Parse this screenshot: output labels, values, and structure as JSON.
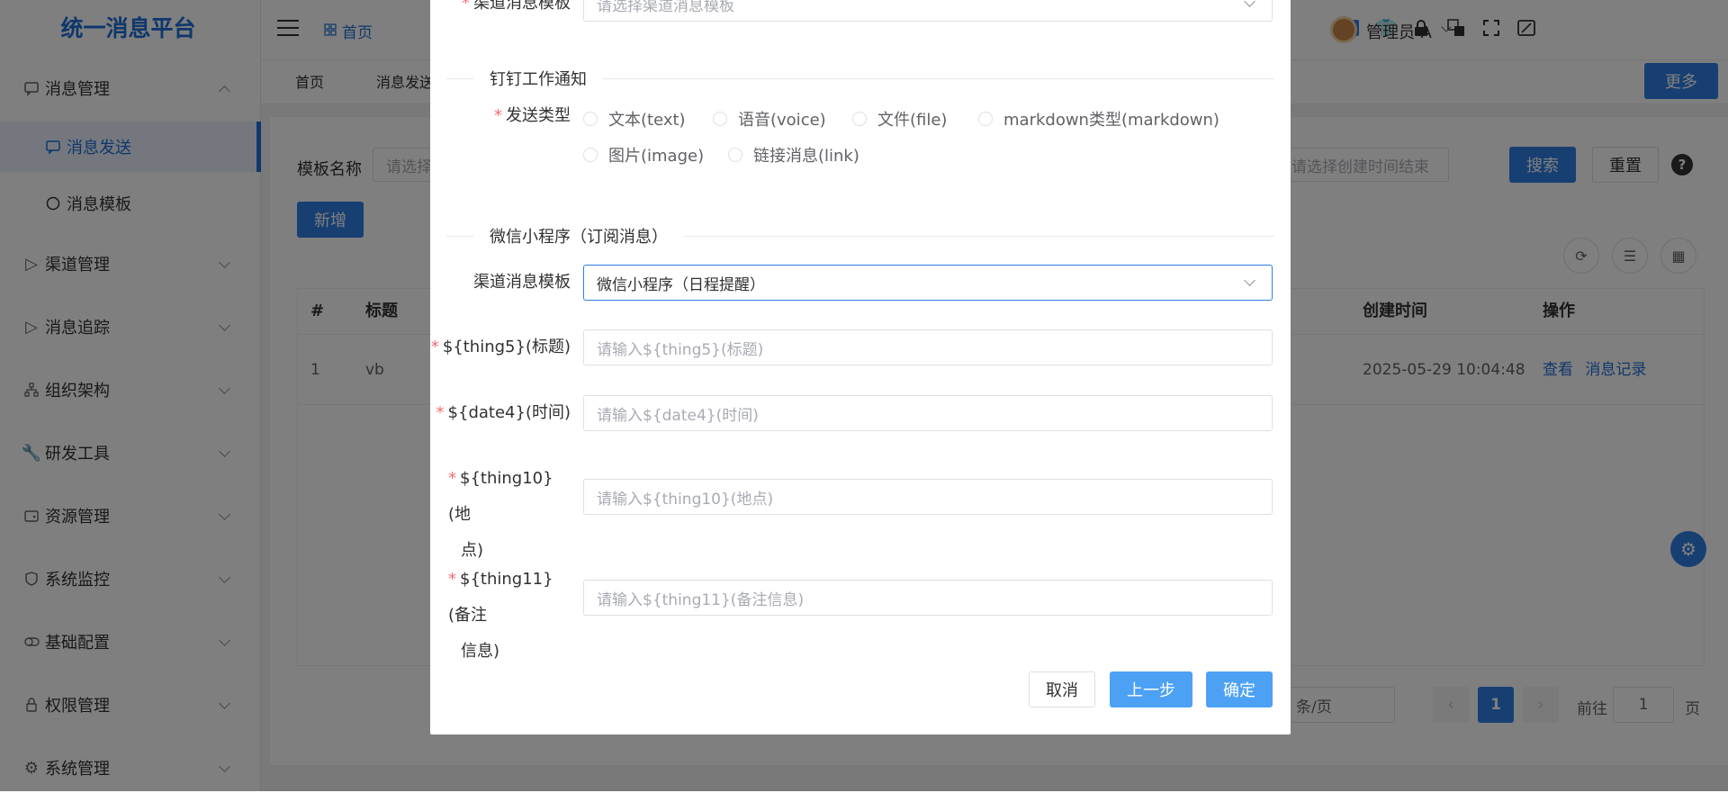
{
  "app": {
    "title": "统一消息平台"
  },
  "sidebar": {
    "items": [
      {
        "label": "消息管理",
        "icon": "message-icon"
      },
      {
        "label": "消息发送",
        "icon": "chat-icon",
        "active": true
      },
      {
        "label": "消息模板",
        "icon": "circle-icon"
      },
      {
        "label": "渠道管理",
        "icon": "send-icon"
      },
      {
        "label": "消息追踪",
        "icon": "send-icon"
      },
      {
        "label": "组织架构",
        "icon": "org-icon"
      },
      {
        "label": "研发工具",
        "icon": "wrench-icon"
      },
      {
        "label": "资源管理",
        "icon": "wallet-icon"
      },
      {
        "label": "系统监控",
        "icon": "shield-icon"
      },
      {
        "label": "基础配置",
        "icon": "toggle-icon"
      },
      {
        "label": "权限管理",
        "icon": "lock-icon"
      },
      {
        "label": "系统管理",
        "icon": "gear-icon"
      }
    ]
  },
  "header": {
    "breadcrumb": "首页",
    "user": "管理员-A"
  },
  "tabs": {
    "home": "首页",
    "current": "消息发送",
    "more": "更多"
  },
  "search": {
    "template_label": "模板名称",
    "template_placeholder": "请选择模板",
    "end_time_placeholder": "请选择创建时间结束",
    "search_btn": "搜索",
    "reset_btn": "重置",
    "add_btn": "新增"
  },
  "table": {
    "headers": {
      "index": "#",
      "title": "标题",
      "created": "创建时间",
      "actions": "操作"
    },
    "rows": [
      {
        "index": "1",
        "title": "vb",
        "created": "2025-05-29 10:04:48",
        "view": "查看",
        "record": "消息记录"
      }
    ]
  },
  "pager": {
    "per_page": "条/页",
    "current": "1",
    "goto_label": "前往",
    "goto_value": "1",
    "page_suffix": "页"
  },
  "dialog": {
    "top_field": {
      "label": "渠道消息模板",
      "placeholder": "请选择渠道消息模板"
    },
    "dingtalk": {
      "section": "钉钉工作通知",
      "send_type_label": "发送类型",
      "options": [
        "文本(text)",
        "语音(voice)",
        "文件(file)",
        "markdown类型(markdown)",
        "图片(image)",
        "链接消息(link)"
      ]
    },
    "wechat": {
      "section": "微信小程序（订阅消息）",
      "template_label": "渠道消息模板",
      "template_value": "微信小程序（日程提醒）",
      "fields": [
        {
          "label": "${thing5}(标题)",
          "placeholder": "请输入${thing5}(标题)"
        },
        {
          "label": "${date4}(时间)",
          "placeholder": "请输入${date4}(时间)"
        },
        {
          "label_line1": "${thing10}(地",
          "label_line2": "点)",
          "placeholder": "请输入${thing10}(地点)"
        },
        {
          "label_line1": "${thing11}(备注",
          "label_line2": "信息)",
          "placeholder": "请输入${thing11}(备注信息)"
        }
      ]
    },
    "buttons": {
      "cancel": "取消",
      "prev": "上一步",
      "confirm": "确定"
    }
  },
  "colors": {
    "primary": "#2e7ee5",
    "required": "#f56c6c",
    "overlay": "rgba(0,0,0,0.5)"
  }
}
